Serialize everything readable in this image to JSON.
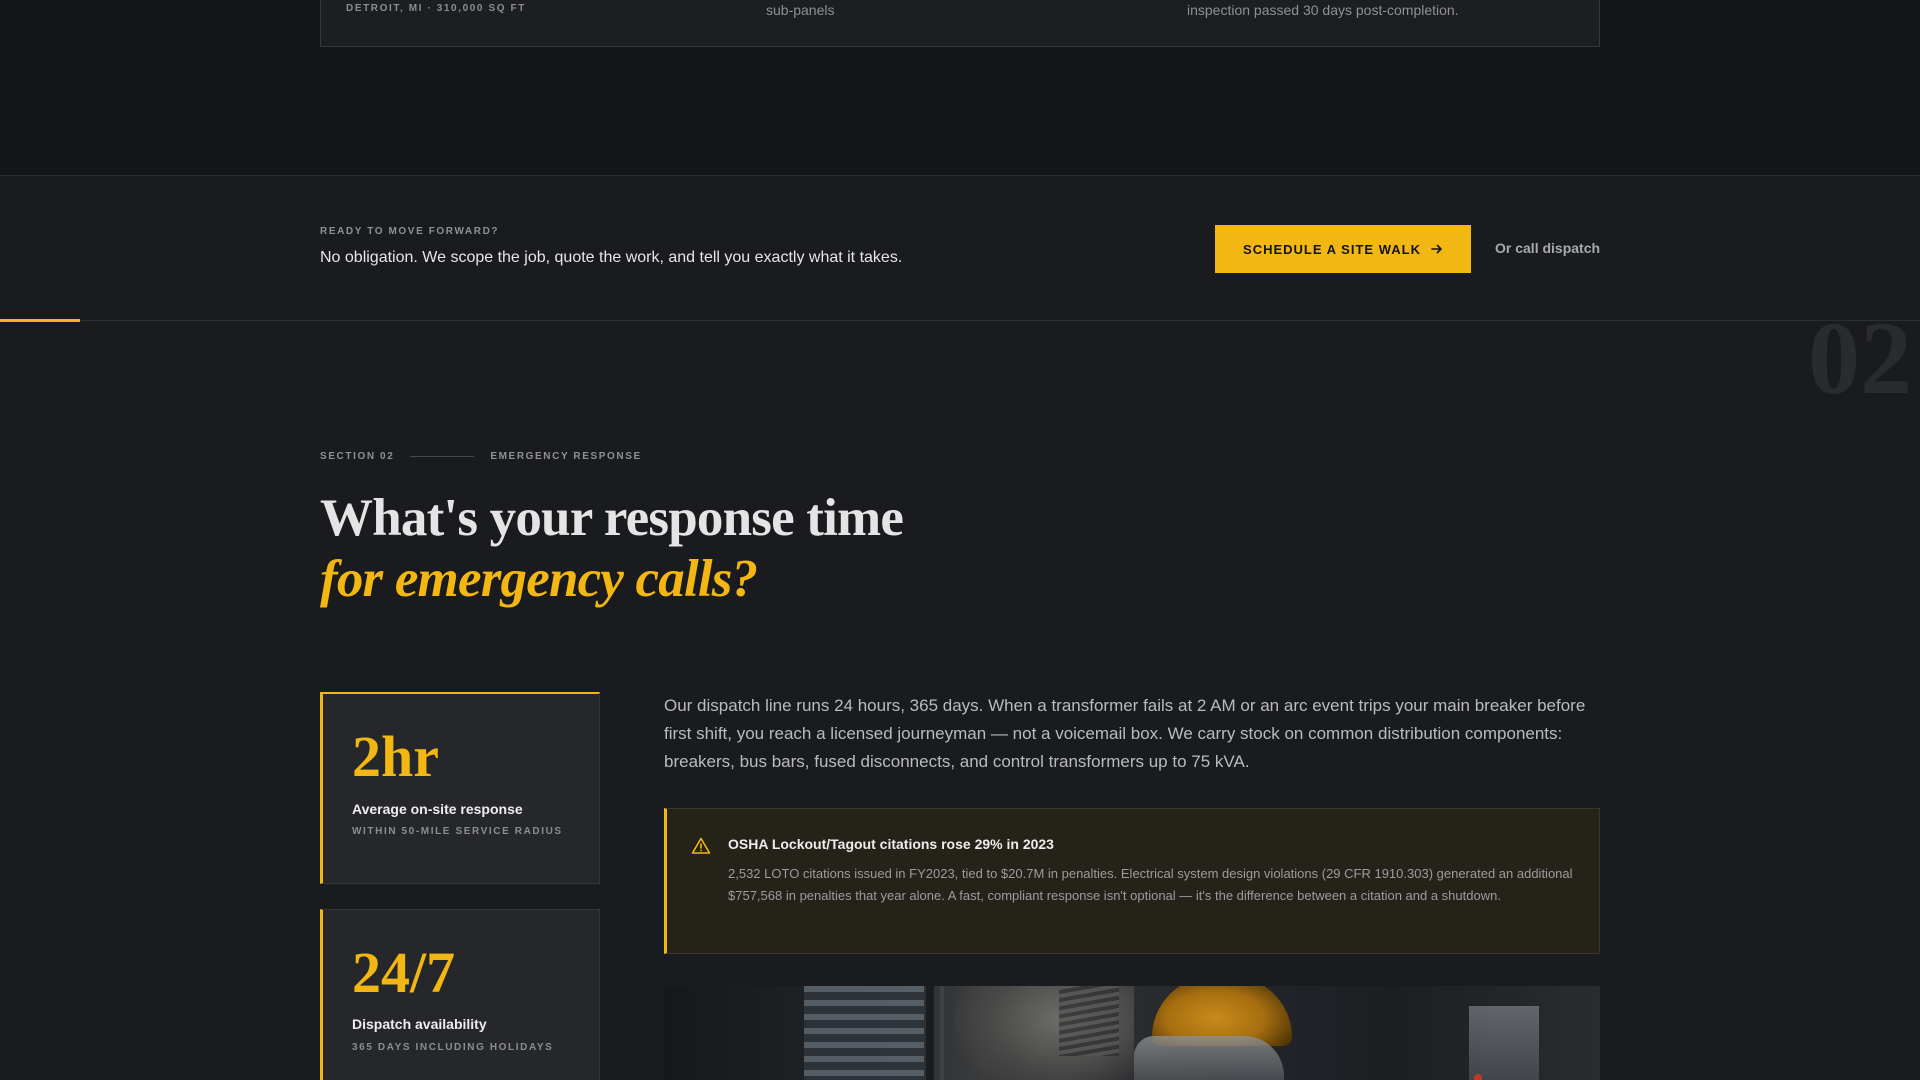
{
  "project_card": {
    "location": "DETROIT, MI · 310,000 SQ FT",
    "col2": "sub-panels",
    "col3": "inspection passed 30 days post-completion."
  },
  "cta": {
    "eyebrow": "READY TO MOVE FORWARD?",
    "text": "No obligation. We scope the job, quote the work, and tell you exactly what it takes.",
    "button_label": "SCHEDULE A SITE WALK",
    "call_link": "Or call dispatch"
  },
  "section": {
    "watermark": "02",
    "number": "SECTION 02",
    "topic": "EMERGENCY RESPONSE",
    "headline_line1": "What's your response time",
    "headline_line2": "for emergency calls?"
  },
  "stats": [
    {
      "value": "2hr",
      "label": "Average on-site response",
      "sub": "WITHIN 50-MILE SERVICE RADIUS"
    },
    {
      "value": "24/7",
      "label": "Dispatch availability",
      "sub": "365 DAYS INCLUDING HOLIDAYS"
    }
  ],
  "body": "Our dispatch line runs 24 hours, 365 days. When a transformer fails at 2 AM or an arc event trips your main breaker before first shift, you reach a licensed journeyman — not a voicemail box. We carry stock on common distribution components: breakers, bus bars, fused disconnects, and control transformers up to 75 kVA.",
  "alert": {
    "title": "OSHA Lockout/Tagout citations rose 29% in 2023",
    "body": "2,532 LOTO citations issued in FY2023, tied to $20.7M in penalties. Electrical system design violations (29 CFR 1910.303) generated an additional $757,568 in penalties that year alone. A fast, compliant response isn't optional — it's the difference between a citation and a shutdown."
  },
  "colors": {
    "accent": "#f2b713",
    "background": "#1a1b1e",
    "card": "#26272b",
    "alert_bg": "#25221a"
  },
  "icons": {
    "cta_button": "arrow-right-icon",
    "alert": "warning-triangle-icon"
  }
}
